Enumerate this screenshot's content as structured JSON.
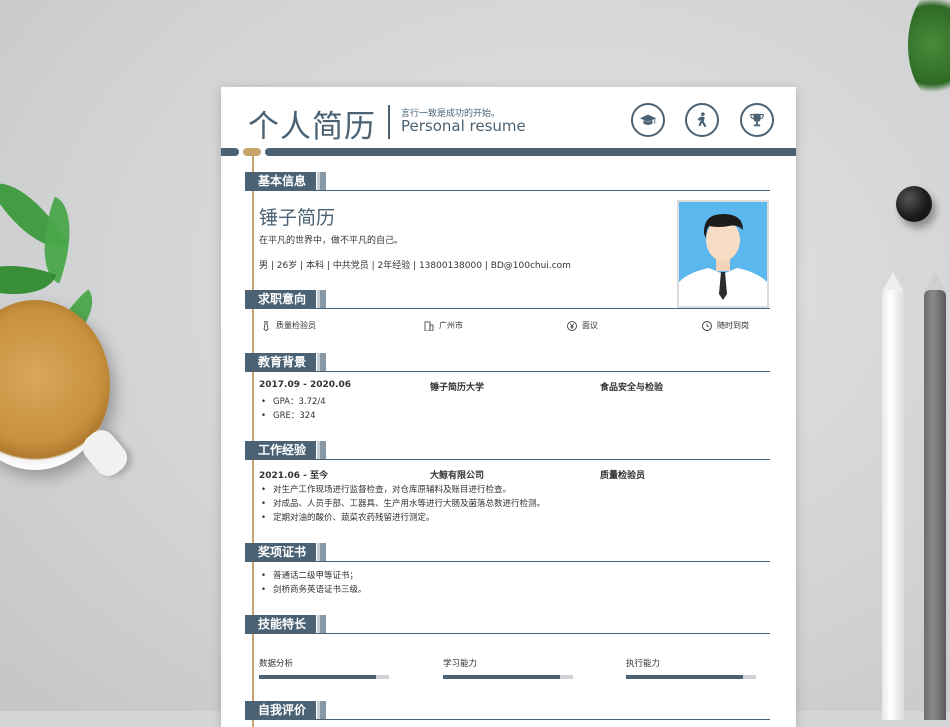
{
  "header": {
    "title": "个人简历",
    "motto": "言行一致是成功的开始。",
    "subtitle": "Personal resume",
    "icons": [
      "graduation-cap-icon",
      "walking-person-icon",
      "trophy-icon"
    ]
  },
  "basic": {
    "section_title": "基本信息",
    "name": "锤子简历",
    "motto": "在平凡的世界中，做不平凡的自己。",
    "details": "男 | 26岁 | 本科 | 中共党员 | 2年经验 | 13800138000 | BD@100chui.com"
  },
  "intent": {
    "section_title": "求职意向",
    "items": [
      {
        "icon": "tie-icon",
        "text": "质量检验员"
      },
      {
        "icon": "building-icon",
        "text": "广州市"
      },
      {
        "icon": "yen-icon",
        "text": "面议"
      },
      {
        "icon": "clock-icon",
        "text": "随时到岗"
      }
    ]
  },
  "education": {
    "section_title": "教育背景",
    "period": "2017.09 - 2020.06",
    "school": "锤子简历大学",
    "major": "食品安全与检验",
    "bullets": [
      "GPA：3.72/4",
      "GRE：324"
    ]
  },
  "work": {
    "section_title": "工作经验",
    "period": "2021.06 - 至今",
    "company": "大鲸有限公司",
    "role": "质量检验员",
    "bullets": [
      "对生产工作现场进行监督检查，对仓库原辅料及账目进行检查。",
      "对成品、人员手部、工器具、生产用水等进行大肠及菌落总数进行检测。",
      "定期对油的酸价、蔬菜农药残留进行测定。"
    ]
  },
  "awards": {
    "section_title": "奖项证书",
    "bullets": [
      "普通话二级甲等证书；",
      "剑桥商务英语证书三级。"
    ]
  },
  "skills": {
    "section_title": "技能特长",
    "items": [
      {
        "name": "数据分析",
        "level": 0.9
      },
      {
        "name": "学习能力",
        "level": 0.9
      },
      {
        "name": "执行能力",
        "level": 0.9
      }
    ]
  },
  "evaluation": {
    "section_title": "自我评价"
  },
  "colors": {
    "accent": "#4a6274",
    "gold": "#c9a46a",
    "background": "#d5d6d8"
  }
}
